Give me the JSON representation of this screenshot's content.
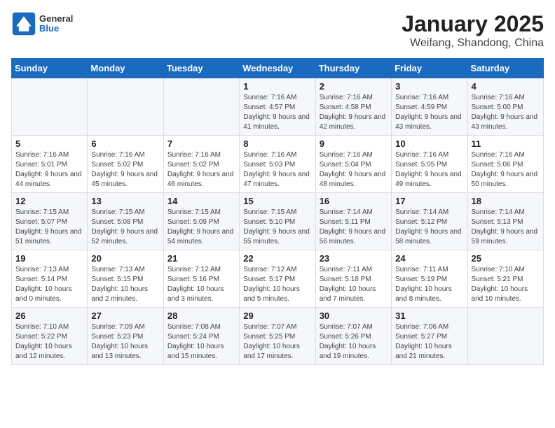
{
  "header": {
    "logo_general": "General",
    "logo_blue": "Blue",
    "month_title": "January 2025",
    "subtitle": "Weifang, Shandong, China"
  },
  "weekdays": [
    "Sunday",
    "Monday",
    "Tuesday",
    "Wednesday",
    "Thursday",
    "Friday",
    "Saturday"
  ],
  "weeks": [
    [
      {
        "day": "",
        "info": ""
      },
      {
        "day": "",
        "info": ""
      },
      {
        "day": "",
        "info": ""
      },
      {
        "day": "1",
        "info": "Sunrise: 7:16 AM\nSunset: 4:57 PM\nDaylight: 9 hours and 41 minutes."
      },
      {
        "day": "2",
        "info": "Sunrise: 7:16 AM\nSunset: 4:58 PM\nDaylight: 9 hours and 42 minutes."
      },
      {
        "day": "3",
        "info": "Sunrise: 7:16 AM\nSunset: 4:59 PM\nDaylight: 9 hours and 43 minutes."
      },
      {
        "day": "4",
        "info": "Sunrise: 7:16 AM\nSunset: 5:00 PM\nDaylight: 9 hours and 43 minutes."
      }
    ],
    [
      {
        "day": "5",
        "info": "Sunrise: 7:16 AM\nSunset: 5:01 PM\nDaylight: 9 hours and 44 minutes."
      },
      {
        "day": "6",
        "info": "Sunrise: 7:16 AM\nSunset: 5:02 PM\nDaylight: 9 hours and 45 minutes."
      },
      {
        "day": "7",
        "info": "Sunrise: 7:16 AM\nSunset: 5:02 PM\nDaylight: 9 hours and 46 minutes."
      },
      {
        "day": "8",
        "info": "Sunrise: 7:16 AM\nSunset: 5:03 PM\nDaylight: 9 hours and 47 minutes."
      },
      {
        "day": "9",
        "info": "Sunrise: 7:16 AM\nSunset: 5:04 PM\nDaylight: 9 hours and 48 minutes."
      },
      {
        "day": "10",
        "info": "Sunrise: 7:16 AM\nSunset: 5:05 PM\nDaylight: 9 hours and 49 minutes."
      },
      {
        "day": "11",
        "info": "Sunrise: 7:16 AM\nSunset: 5:06 PM\nDaylight: 9 hours and 50 minutes."
      }
    ],
    [
      {
        "day": "12",
        "info": "Sunrise: 7:15 AM\nSunset: 5:07 PM\nDaylight: 9 hours and 51 minutes."
      },
      {
        "day": "13",
        "info": "Sunrise: 7:15 AM\nSunset: 5:08 PM\nDaylight: 9 hours and 52 minutes."
      },
      {
        "day": "14",
        "info": "Sunrise: 7:15 AM\nSunset: 5:09 PM\nDaylight: 9 hours and 54 minutes."
      },
      {
        "day": "15",
        "info": "Sunrise: 7:15 AM\nSunset: 5:10 PM\nDaylight: 9 hours and 55 minutes."
      },
      {
        "day": "16",
        "info": "Sunrise: 7:14 AM\nSunset: 5:11 PM\nDaylight: 9 hours and 56 minutes."
      },
      {
        "day": "17",
        "info": "Sunrise: 7:14 AM\nSunset: 5:12 PM\nDaylight: 9 hours and 58 minutes."
      },
      {
        "day": "18",
        "info": "Sunrise: 7:14 AM\nSunset: 5:13 PM\nDaylight: 9 hours and 59 minutes."
      }
    ],
    [
      {
        "day": "19",
        "info": "Sunrise: 7:13 AM\nSunset: 5:14 PM\nDaylight: 10 hours and 0 minutes."
      },
      {
        "day": "20",
        "info": "Sunrise: 7:13 AM\nSunset: 5:15 PM\nDaylight: 10 hours and 2 minutes."
      },
      {
        "day": "21",
        "info": "Sunrise: 7:12 AM\nSunset: 5:16 PM\nDaylight: 10 hours and 3 minutes."
      },
      {
        "day": "22",
        "info": "Sunrise: 7:12 AM\nSunset: 5:17 PM\nDaylight: 10 hours and 5 minutes."
      },
      {
        "day": "23",
        "info": "Sunrise: 7:11 AM\nSunset: 5:18 PM\nDaylight: 10 hours and 7 minutes."
      },
      {
        "day": "24",
        "info": "Sunrise: 7:11 AM\nSunset: 5:19 PM\nDaylight: 10 hours and 8 minutes."
      },
      {
        "day": "25",
        "info": "Sunrise: 7:10 AM\nSunset: 5:21 PM\nDaylight: 10 hours and 10 minutes."
      }
    ],
    [
      {
        "day": "26",
        "info": "Sunrise: 7:10 AM\nSunset: 5:22 PM\nDaylight: 10 hours and 12 minutes."
      },
      {
        "day": "27",
        "info": "Sunrise: 7:09 AM\nSunset: 5:23 PM\nDaylight: 10 hours and 13 minutes."
      },
      {
        "day": "28",
        "info": "Sunrise: 7:08 AM\nSunset: 5:24 PM\nDaylight: 10 hours and 15 minutes."
      },
      {
        "day": "29",
        "info": "Sunrise: 7:07 AM\nSunset: 5:25 PM\nDaylight: 10 hours and 17 minutes."
      },
      {
        "day": "30",
        "info": "Sunrise: 7:07 AM\nSunset: 5:26 PM\nDaylight: 10 hours and 19 minutes."
      },
      {
        "day": "31",
        "info": "Sunrise: 7:06 AM\nSunset: 5:27 PM\nDaylight: 10 hours and 21 minutes."
      },
      {
        "day": "",
        "info": ""
      }
    ]
  ]
}
